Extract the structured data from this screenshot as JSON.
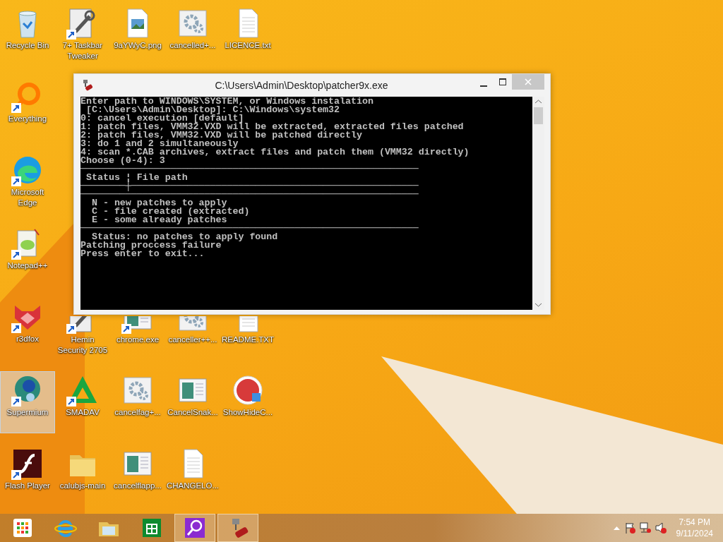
{
  "desktop": {
    "rows": [
      [
        {
          "label": "Recycle Bin",
          "kind": "bin",
          "shortcut": false,
          "selected": false
        },
        {
          "label": "7+ Taskbar Tweaker",
          "kind": "tool",
          "shortcut": true,
          "selected": false
        },
        {
          "label": "9aYWyC.png",
          "kind": "image",
          "shortcut": false,
          "selected": false
        },
        {
          "label": "cancelled+...",
          "kind": "gear",
          "shortcut": false,
          "selected": false
        },
        {
          "label": "LICENCE.txt",
          "kind": "text",
          "shortcut": false,
          "selected": false
        }
      ],
      [
        {
          "label": "Everything",
          "kind": "ring",
          "shortcut": true,
          "selected": false
        }
      ],
      [
        {
          "label": "Microsoft Edge",
          "kind": "edge",
          "shortcut": true,
          "selected": false
        }
      ],
      [
        {
          "label": "Notepad++",
          "kind": "notepad",
          "shortcut": true,
          "selected": false
        }
      ],
      [
        {
          "label": "r3dfox",
          "kind": "fox",
          "shortcut": true,
          "selected": false
        },
        {
          "label": "Hemin Security 2705",
          "kind": "tool",
          "shortcut": true,
          "selected": false
        },
        {
          "label": "chrome.exe",
          "kind": "window",
          "shortcut": true,
          "selected": false
        },
        {
          "label": "canceller++...",
          "kind": "gear",
          "shortcut": false,
          "selected": false
        },
        {
          "label": "README.TXT",
          "kind": "text",
          "shortcut": false,
          "selected": false
        }
      ],
      [
        {
          "label": "Supermium",
          "kind": "globe",
          "shortcut": true,
          "selected": true
        },
        {
          "label": "SMADAV",
          "kind": "triangle",
          "shortcut": true,
          "selected": false
        },
        {
          "label": "cancelfag+...",
          "kind": "gear",
          "shortcut": false,
          "selected": false
        },
        {
          "label": "CancelSnak...",
          "kind": "window",
          "shortcut": false,
          "selected": false
        },
        {
          "label": "ShowHideC...",
          "kind": "badge",
          "shortcut": false,
          "selected": false
        }
      ],
      [
        {
          "label": "Flash Player",
          "kind": "flash",
          "shortcut": true,
          "selected": false
        },
        {
          "label": "calubjs-main",
          "kind": "folder",
          "shortcut": false,
          "selected": false
        },
        {
          "label": "cancelflapp...",
          "kind": "window",
          "shortcut": false,
          "selected": false
        },
        {
          "label": "CHANGELO...",
          "kind": "text",
          "shortcut": false,
          "selected": false
        }
      ]
    ]
  },
  "console": {
    "title": "C:\\Users\\Admin\\Desktop\\patcher9x.exe",
    "lines": [
      "Enter path to WINDOWS\\SYSTEM, or Windows instalation",
      " [C:\\Users\\Admin\\Desktop]: C:\\Windows\\system32",
      "0: cancel execution [default]",
      "1: patch files, VMM32.VXD will be extracted, extracted files patched",
      "2: patch files, VMM32.VXD will be patched directly",
      "3: do 1 and 2 simultaneously",
      "4: scan *.CAB archives, extract files and patch them (VMM32 directly)",
      "Choose (0-4): 3",
      "────────────────────────────────────────────────────────────",
      " Status ¦ File path",
      "────────┼───────────────────────────────────────────────────",
      "────────────────────────────────────────────────────────────",
      "  N - new patches to apply",
      "  C - file created (extracted)",
      "  E - some already patches",
      "────────────────────────────────────────────────────────────",
      "  Status: no patches to apply found",
      "Patching proccess failure",
      "Press enter to exit..."
    ]
  },
  "taskbar": {
    "apps": [
      {
        "kind": "start",
        "active": false
      },
      {
        "kind": "ie",
        "active": false
      },
      {
        "kind": "explorer",
        "active": false
      },
      {
        "kind": "store",
        "active": false
      },
      {
        "kind": "search",
        "active": true
      },
      {
        "kind": "patcher",
        "active": true
      }
    ],
    "clock": {
      "time": "7:54 PM",
      "date": "9/11/2024"
    }
  }
}
